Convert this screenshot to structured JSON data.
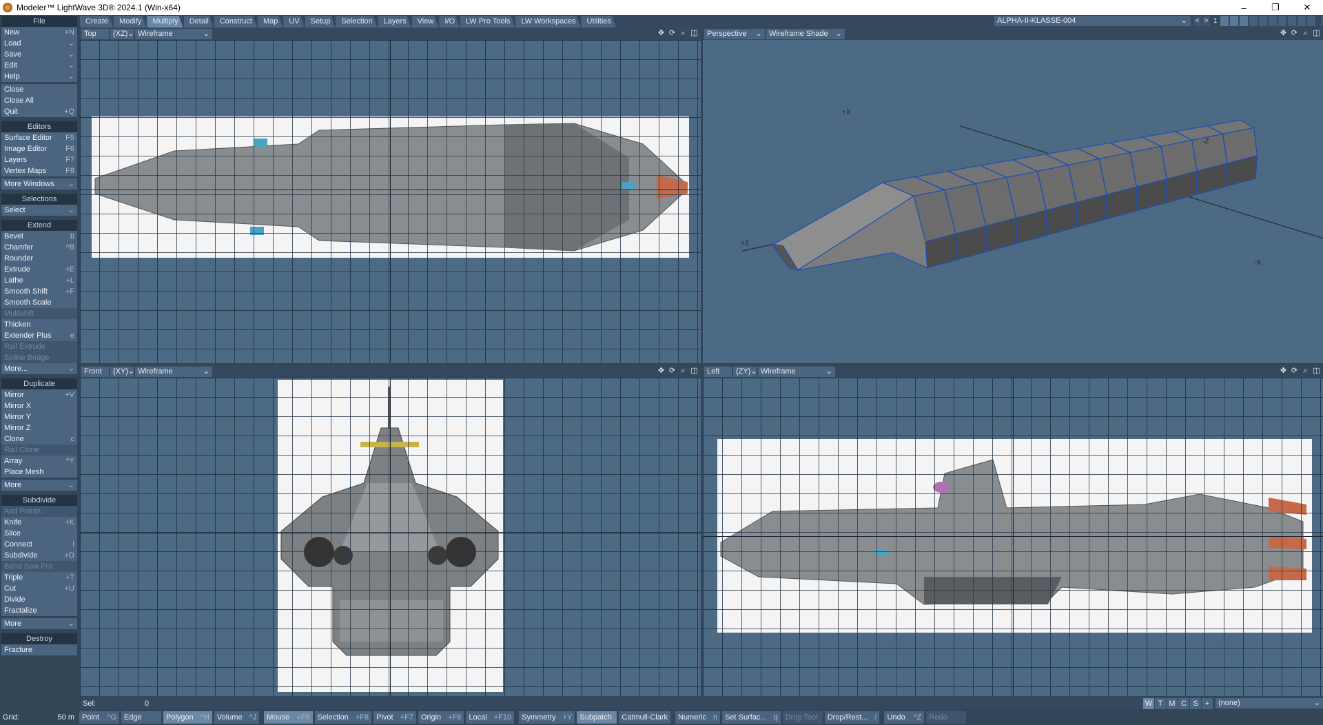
{
  "window": {
    "title": "Modeler™ LightWave 3D® 2024.1 (Win-x64)",
    "minimize": "–",
    "maximize": "❐",
    "close": "✕"
  },
  "tabs": [
    "Create",
    "Modify",
    "Multiply",
    "Detail",
    "Construct",
    "Map",
    "UV",
    "Setup",
    "Selection",
    "Layers",
    "View",
    "I/O",
    "LW Pro Tools",
    "LW Workspaces",
    "Utilities"
  ],
  "active_tab": "Multiply",
  "layer": {
    "object": "ALPHA-II-KLASSE-004",
    "prev": "<",
    "next": ">",
    "current_layer": "1"
  },
  "sidebar": [
    {
      "header": "File",
      "blocks": [
        [
          {
            "l": "New",
            "s": "+N"
          },
          {
            "l": "Load",
            "s": "⌄"
          },
          {
            "l": "Save",
            "s": "⌄"
          },
          {
            "l": "Edit",
            "s": "⌄"
          },
          {
            "l": "Help",
            "s": "⌄"
          }
        ],
        [
          {
            "l": "Close",
            "s": ""
          },
          {
            "l": "Close All",
            "s": ""
          },
          {
            "l": "Quit",
            "s": "+Q"
          }
        ]
      ]
    },
    {
      "header": "Editors",
      "blocks": [
        [
          {
            "l": "Surface Editor",
            "s": "F5"
          },
          {
            "l": "Image Editor",
            "s": "F6"
          },
          {
            "l": "Layers",
            "s": "F7"
          },
          {
            "l": "Vertex Maps",
            "s": "F8"
          }
        ],
        [
          {
            "l": "More Windows",
            "s": "⌄"
          }
        ]
      ]
    },
    {
      "header": "Selections",
      "blocks": [
        [
          {
            "l": "Select",
            "s": "⌄"
          }
        ]
      ]
    },
    {
      "header": "Extend",
      "blocks": [
        [
          {
            "l": "Bevel",
            "s": "b"
          },
          {
            "l": "Chamfer",
            "s": "^B"
          },
          {
            "l": "Rounder",
            "s": ""
          },
          {
            "l": "Extrude",
            "s": "+E"
          },
          {
            "l": "Lathe",
            "s": "+L"
          },
          {
            "l": "Smooth Shift",
            "s": "+F"
          },
          {
            "l": "Smooth Scale",
            "s": ""
          },
          {
            "l": "Multishift",
            "s": "",
            "d": true
          },
          {
            "l": "Thicken",
            "s": ""
          },
          {
            "l": "Extender Plus",
            "s": "e"
          },
          {
            "l": "Rail Extrude",
            "s": "",
            "d": true
          },
          {
            "l": "Spline Bridge",
            "s": "",
            "d": true
          },
          {
            "l": "More...",
            "s": "⌄"
          }
        ]
      ]
    },
    {
      "header": "Duplicate",
      "blocks": [
        [
          {
            "l": "Mirror",
            "s": "+V"
          },
          {
            "l": "Mirror X",
            "s": ""
          },
          {
            "l": "Mirror Y",
            "s": ""
          },
          {
            "l": "Mirror Z",
            "s": ""
          },
          {
            "l": "Clone",
            "s": "c"
          },
          {
            "l": "Rail Clone",
            "s": "",
            "d": true
          },
          {
            "l": "Array",
            "s": "^Y"
          },
          {
            "l": "Place Mesh",
            "s": ""
          }
        ],
        [
          {
            "l": "More",
            "s": "⌄"
          }
        ]
      ]
    },
    {
      "header": "Subdivide",
      "blocks": [
        [
          {
            "l": "Add Points",
            "s": "",
            "d": true
          },
          {
            "l": "Knife",
            "s": "+K"
          },
          {
            "l": "Slice",
            "s": ""
          },
          {
            "l": "Connect",
            "s": "l"
          },
          {
            "l": "Subdivide",
            "s": "+D"
          },
          {
            "l": "Band Saw Pro",
            "s": "",
            "d": true
          },
          {
            "l": "Triple",
            "s": "+T"
          },
          {
            "l": "Cut",
            "s": "+U"
          },
          {
            "l": "Divide",
            "s": ""
          },
          {
            "l": "Fractalize",
            "s": ""
          }
        ],
        [
          {
            "l": "More",
            "s": "⌄"
          }
        ]
      ]
    },
    {
      "header": "Destroy",
      "blocks": [
        [
          {
            "l": "Fracture",
            "s": ""
          }
        ]
      ]
    }
  ],
  "viewports": {
    "top": {
      "view": "Top",
      "axes": "(XZ)",
      "mode": "Wireframe"
    },
    "perspective": {
      "view": "Perspective",
      "mode": "Wireframe Shade",
      "labels": [
        "+X",
        "-Z",
        "+Z",
        "-X"
      ]
    },
    "front": {
      "view": "Front",
      "axes": "(XY)",
      "mode": "Wireframe"
    },
    "left": {
      "view": "Left",
      "axes": "(ZY)",
      "mode": "Wireframe"
    }
  },
  "status": {
    "sel_label": "Sel:",
    "sel_value": "0",
    "wtmcs": [
      "W",
      "T",
      "M",
      "C",
      "S",
      "+"
    ],
    "surface": "(none)",
    "grid_label": "Grid:",
    "grid_value": "50 m",
    "buttons": [
      {
        "l": "Point",
        "s": "^G"
      },
      {
        "l": "Edge",
        "s": ""
      },
      {
        "l": "Polygon",
        "s": "^H",
        "on": true
      },
      {
        "l": "Volume",
        "s": "^J"
      },
      {
        "l": "Mouse",
        "s": "+F5",
        "on": true
      },
      {
        "l": "Selection",
        "s": "+F8"
      },
      {
        "l": "Pivot",
        "s": "+F7"
      },
      {
        "l": "Origin",
        "s": "+F6"
      },
      {
        "l": "Local",
        "s": "+F10"
      },
      {
        "l": "Symmetry",
        "s": "+Y"
      },
      {
        "l": "Subpatch",
        "s": "",
        "on": true
      },
      {
        "l": "Catmull-Clark",
        "s": ""
      },
      {
        "l": "Numeric",
        "s": "n"
      },
      {
        "l": "Set Surfac...",
        "s": "q"
      },
      {
        "l": "Drop Tool",
        "s": "",
        "d": true
      },
      {
        "l": "Drop/Rest...",
        "s": "/"
      },
      {
        "l": "Undo",
        "s": "^Z"
      },
      {
        "l": "Redo",
        "s": "",
        "d": true
      }
    ]
  }
}
